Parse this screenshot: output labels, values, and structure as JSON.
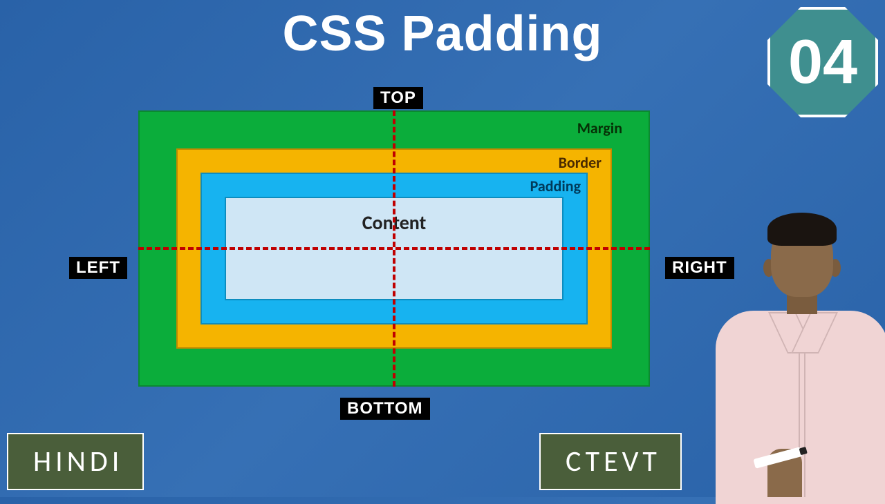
{
  "title": "CSS Padding",
  "episode": "04",
  "directions": {
    "top": "TOP",
    "bottom": "BOTTOM",
    "left": "LEFT",
    "right": "RIGHT"
  },
  "box_model": {
    "margin": "Margin",
    "border": "Border",
    "padding": "Padding",
    "content": "Content"
  },
  "tags": {
    "language": "HINDI",
    "org": "CTEVT"
  },
  "colors": {
    "margin": "#0bad3b",
    "border": "#f5b400",
    "padding": "#17b3f0",
    "content": "#cfe6f5",
    "dashed": "#c00000",
    "badge": "#3f8f8f",
    "tag": "#4a5e3a",
    "bg": "#2962a8"
  }
}
